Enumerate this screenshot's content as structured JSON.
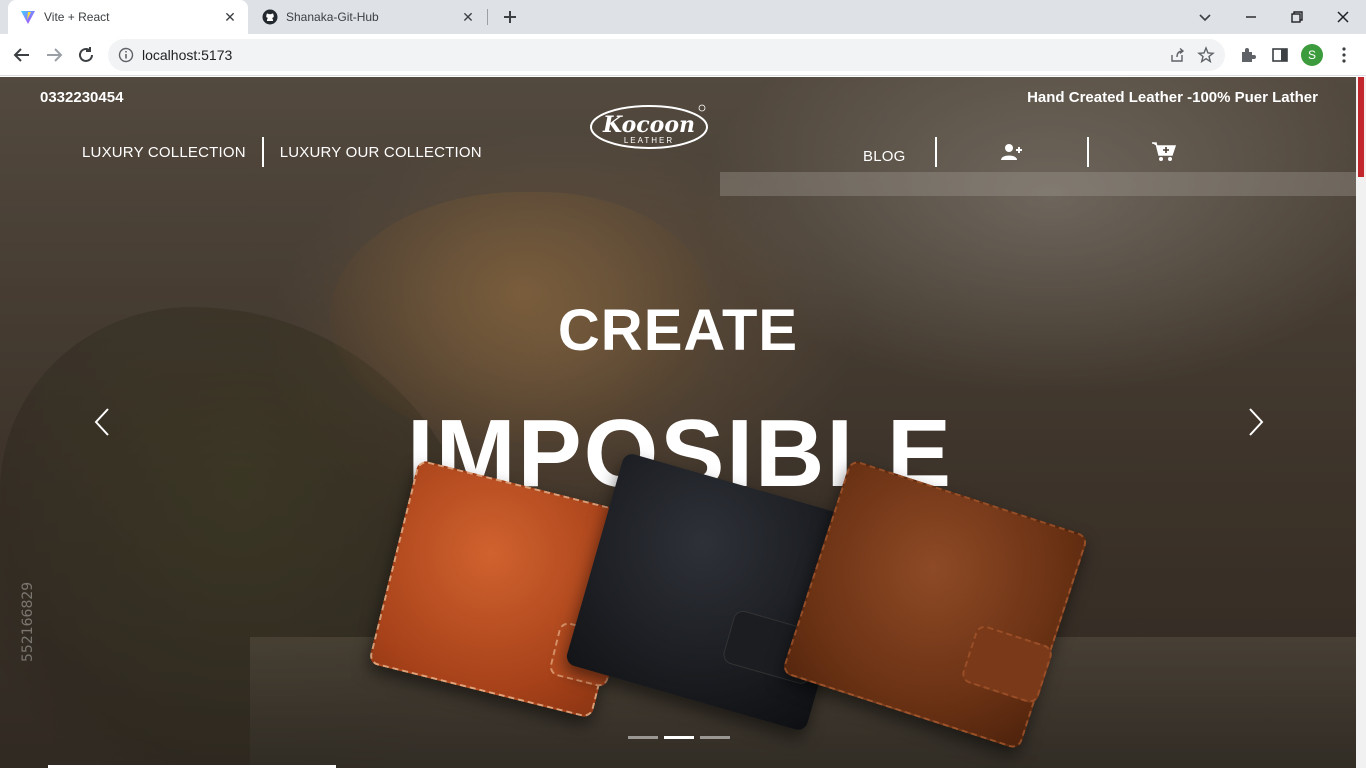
{
  "browser": {
    "tabs": [
      {
        "title": "Vite + React",
        "icon": "vite-icon",
        "active": true
      },
      {
        "title": "Shanaka-Git-Hub",
        "icon": "github-icon",
        "active": false
      }
    ],
    "url": "localhost:5173",
    "profile_initial": "S"
  },
  "topbar": {
    "phone": "0332230454",
    "tagline": "Hand Created Leather -100% Puer Lather"
  },
  "nav": {
    "left": [
      "LUXURY COLLECTION",
      "LUXURY OUR COLLECTION"
    ],
    "blog": "BLOG",
    "logo_text": "Kocoon",
    "logo_sub": "LEATHER"
  },
  "hero": {
    "line1": "CREATE",
    "line2": "IMPOSIBLE",
    "active_slide": 2,
    "slide_count": 3
  },
  "background": {
    "stock_id": "552166829"
  },
  "colors": {
    "accent_scroll": "#c1272d",
    "text": "#ffffff"
  }
}
